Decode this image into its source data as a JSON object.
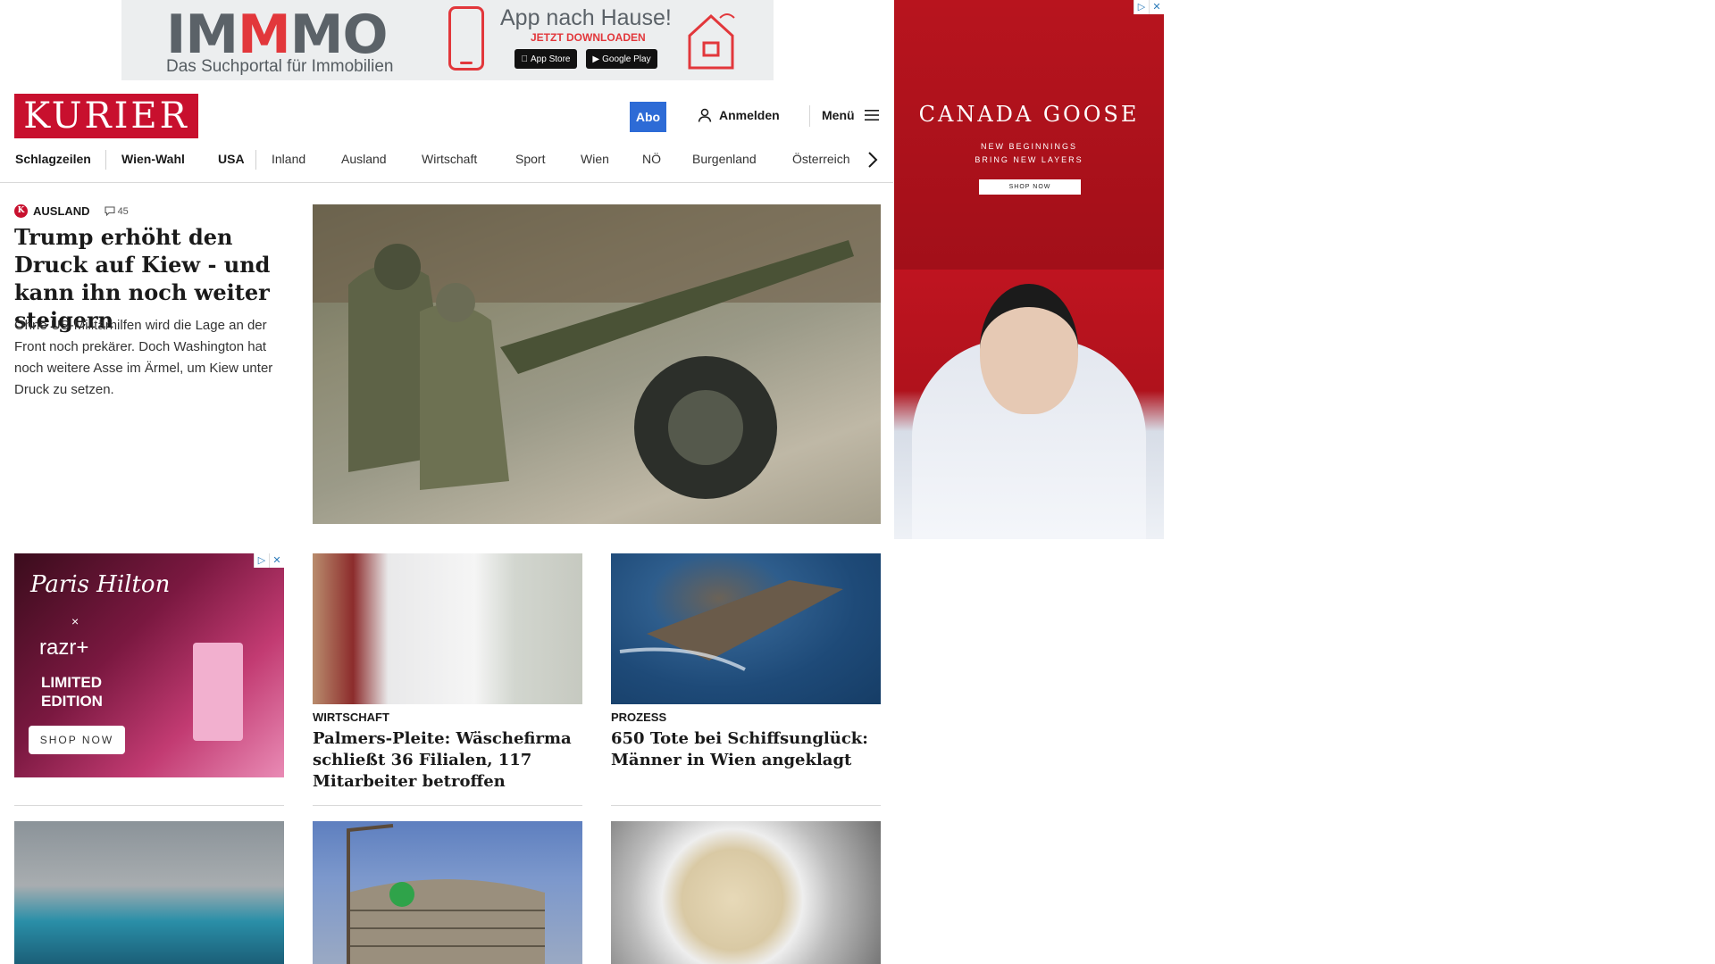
{
  "top_banner": {
    "brand_prefix": "IM",
    "brand_red": "M",
    "brand_suffix": "MO",
    "tagline": "Das Suchportal für Immobilien",
    "headline": "App nach Hause!",
    "cta": "JETZT DOWNLOADEN",
    "app_store": "App Store",
    "google_play": "Google Play"
  },
  "header": {
    "logo": "KURIER",
    "abo_label": "Abo",
    "login_label": "Anmelden",
    "menu_label": "Menü"
  },
  "nav": {
    "items": [
      "Schlagzeilen",
      "Wien-Wahl",
      "USA",
      "Inland",
      "Ausland",
      "Wirtschaft",
      "Sport",
      "Wien",
      "NÖ",
      "Burgenland",
      "Österreich"
    ]
  },
  "lead": {
    "section": "AUSLAND",
    "badge": "K",
    "comment_count": "45",
    "title": "Trump erhöht den Druck auf Kiew - und kann ihn noch weiter steigern",
    "teaser": "Ohne US-Militärhilfen wird die Lage an der Front noch prekärer. Doch Washington hat noch weitere Asse im Ärmel, um Kiew unter Druck zu setzen."
  },
  "articles": [
    {
      "kicker": "WIRTSCHAFT",
      "title": "Palmers-Pleite: Wäschefirma schließt 36 Filialen, 117 Mitarbeiter betroffen"
    },
    {
      "kicker": "PROZESS",
      "title": "650 Tote bei Schiffsunglück: Männer in Wien angeklagt"
    }
  ],
  "ad_paris": {
    "script": "Paris Hilton",
    "x": "×",
    "brand": "razr+",
    "limited": "LIMITED",
    "edition": "EDITION",
    "cta": "SHOP NOW"
  },
  "ad_canada": {
    "brand": "CANADA GOOSE",
    "line1": "NEW BEGINNINGS",
    "line2": "BRING NEW LAYERS",
    "cta": "SHOP NOW"
  },
  "colors": {
    "brand_red": "#c8102e",
    "abo_blue": "#2d6bd6"
  }
}
